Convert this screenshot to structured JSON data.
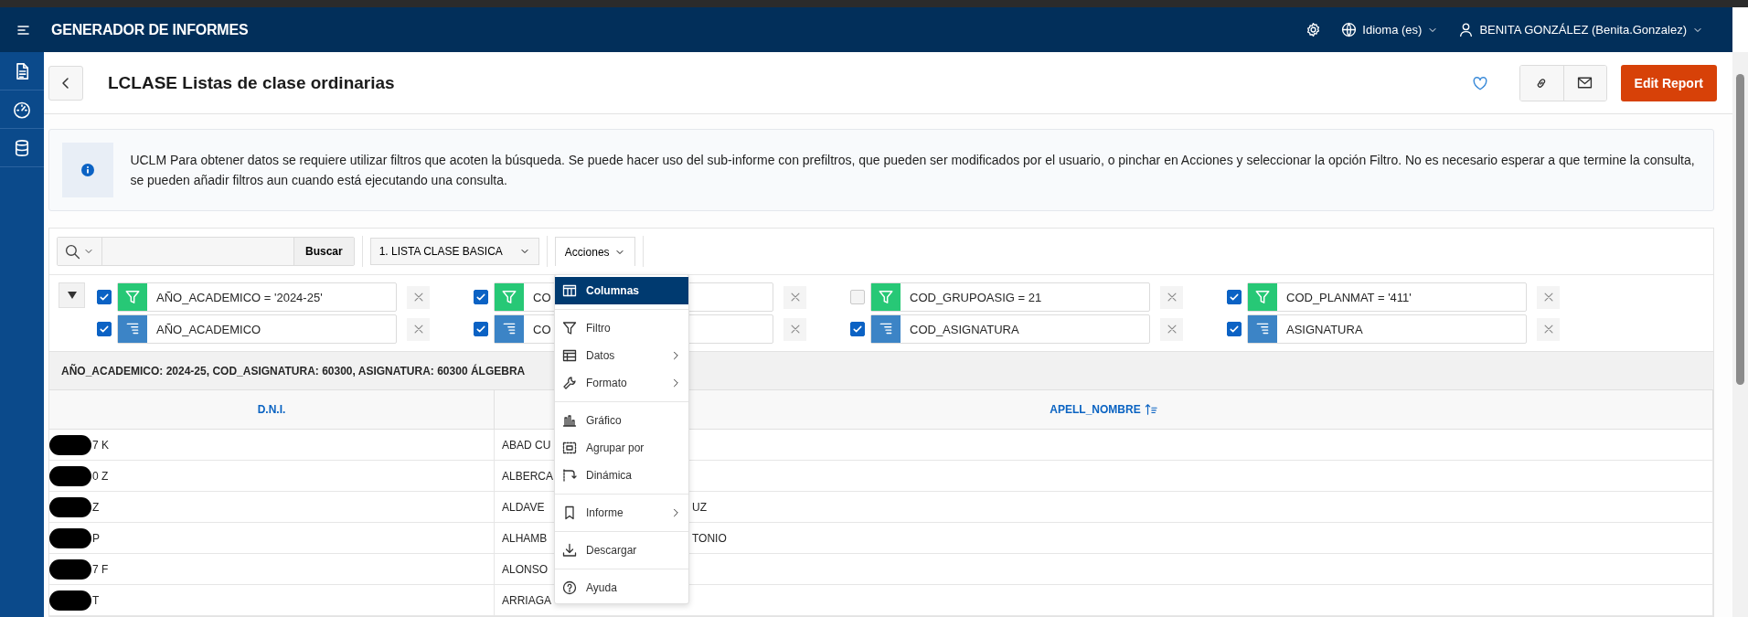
{
  "header": {
    "title": "GENERADOR DE INFORMES",
    "language": "Idioma (es)",
    "user": "BENITA GONZÁLEZ (Benita.Gonzalez)"
  },
  "page": {
    "title": "LCLASE Listas de clase ordinarias",
    "edit_button": "Edit Report"
  },
  "info": {
    "text": "UCLM Para obtener datos se requiere utilizar filtros que acoten la búsqueda. Se puede hacer uso del sub-informe con prefiltros, que pueden ser modificados por el usuario, o pinchar en Acciones y seleccionar la opción Filtro. No es necesario esperar a que termine la consulta, se pueden añadir filtros aun cuando está ejecutando una consulta."
  },
  "toolbar": {
    "search_button": "Buscar",
    "report_select": "1. LISTA CLASE BASICA",
    "actions_button": "Acciones"
  },
  "filters": [
    {
      "kind": "filter",
      "checked": true,
      "label": "AÑO_ACADEMICO = '2024-25'"
    },
    {
      "kind": "filter",
      "checked": true,
      "label": "CO"
    },
    {
      "kind": "filter",
      "checked": false,
      "label": "COD_GRUPOASIG = 21"
    },
    {
      "kind": "filter",
      "checked": true,
      "label": "COD_PLANMAT = '411'"
    },
    {
      "kind": "sort",
      "checked": true,
      "label": "AÑO_ACADEMICO"
    },
    {
      "kind": "sort",
      "checked": true,
      "label": "CO"
    },
    {
      "kind": "sort",
      "checked": true,
      "label": "COD_ASIGNATURA"
    },
    {
      "kind": "sort",
      "checked": true,
      "label": "ASIGNATURA"
    }
  ],
  "group_heading": "AÑO_ACADEMICO: 2024-25, COD_ASIGNATURA: 60300, ASIGNATURA: 60300 ÁLGEBRA",
  "table": {
    "columns": [
      "D.N.I.",
      "APELL_NOMBRE"
    ],
    "rows": [
      {
        "dni": "7 K",
        "name": "ABAD CU"
      },
      {
        "dni": "0 Z",
        "name": "ALBERCA"
      },
      {
        "dni": "Z",
        "name": "ALDAVE",
        "name_tail": "UZ"
      },
      {
        "dni": "P",
        "name": "ALHAMB",
        "name_tail": "TONIO"
      },
      {
        "dni": "7 F",
        "name": "ALONSO"
      },
      {
        "dni": "T",
        "name": "ARRIAGA"
      }
    ]
  },
  "actions_menu": [
    {
      "kind": "item",
      "label": "Columnas",
      "selected": true
    },
    {
      "kind": "divider"
    },
    {
      "kind": "item",
      "label": "Filtro",
      "selected": false
    },
    {
      "kind": "submenu",
      "label": "Datos",
      "selected": false
    },
    {
      "kind": "submenu",
      "label": "Formato",
      "selected": false
    },
    {
      "kind": "divider"
    },
    {
      "kind": "item",
      "label": "Gráfico",
      "selected": false
    },
    {
      "kind": "item",
      "label": "Agrupar por",
      "selected": false
    },
    {
      "kind": "item",
      "label": "Dinámica",
      "selected": false
    },
    {
      "kind": "divider"
    },
    {
      "kind": "submenu",
      "label": "Informe",
      "selected": false
    },
    {
      "kind": "divider"
    },
    {
      "kind": "item",
      "label": "Descargar",
      "selected": false
    },
    {
      "kind": "divider"
    },
    {
      "kind": "item",
      "label": "Ayuda",
      "selected": false
    }
  ]
}
